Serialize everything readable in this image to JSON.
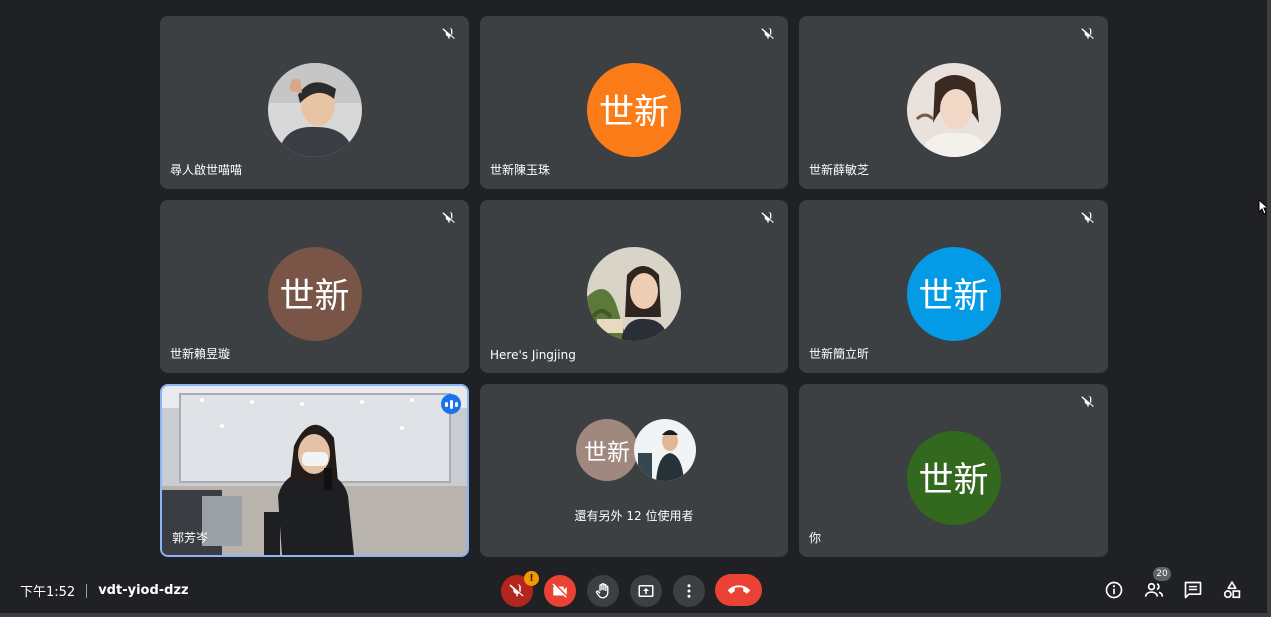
{
  "tiles": [
    {
      "name": "尋人啟世喵喵",
      "avatar": "photo",
      "muted": true
    },
    {
      "name": "世新陳玉珠",
      "avatar_text": "世新",
      "avatar_color": "#fa7b17",
      "muted": true
    },
    {
      "name": "世新薛敏芝",
      "avatar": "photo",
      "muted": true
    },
    {
      "name": "世新賴昱璇",
      "avatar_text": "世新",
      "avatar_color": "#795548",
      "muted": true
    },
    {
      "name": "Here's Jingjing",
      "avatar": "photo",
      "muted": true
    },
    {
      "name": "世新簡立昕",
      "avatar_text": "世新",
      "avatar_color": "#039be5",
      "muted": true
    },
    {
      "name": "郭芳岑",
      "video": true,
      "speaking": true
    },
    {
      "others_label": "還有另外 12 位使用者",
      "avatar_text": "世新",
      "avatar_color": "#a1887f"
    },
    {
      "name": "你",
      "avatar_text": "世新",
      "avatar_color": "#33691e",
      "muted": true
    }
  ],
  "bottom": {
    "time": "下午1:52",
    "meeting_code": "vdt-yiod-dzz",
    "participant_count": "20",
    "mic_alert": "!"
  },
  "colors": {
    "background": "#202124",
    "tile": "#3c4043",
    "hangup": "#ea4335",
    "speaking": "#1a73e8",
    "selected_border": "#8ab4f8"
  },
  "icons": [
    "mic-off-icon",
    "camera-off-icon",
    "raise-hand-icon",
    "present-icon",
    "more-icon",
    "hang-up-icon",
    "info-icon",
    "people-icon",
    "chat-icon",
    "activities-icon"
  ]
}
